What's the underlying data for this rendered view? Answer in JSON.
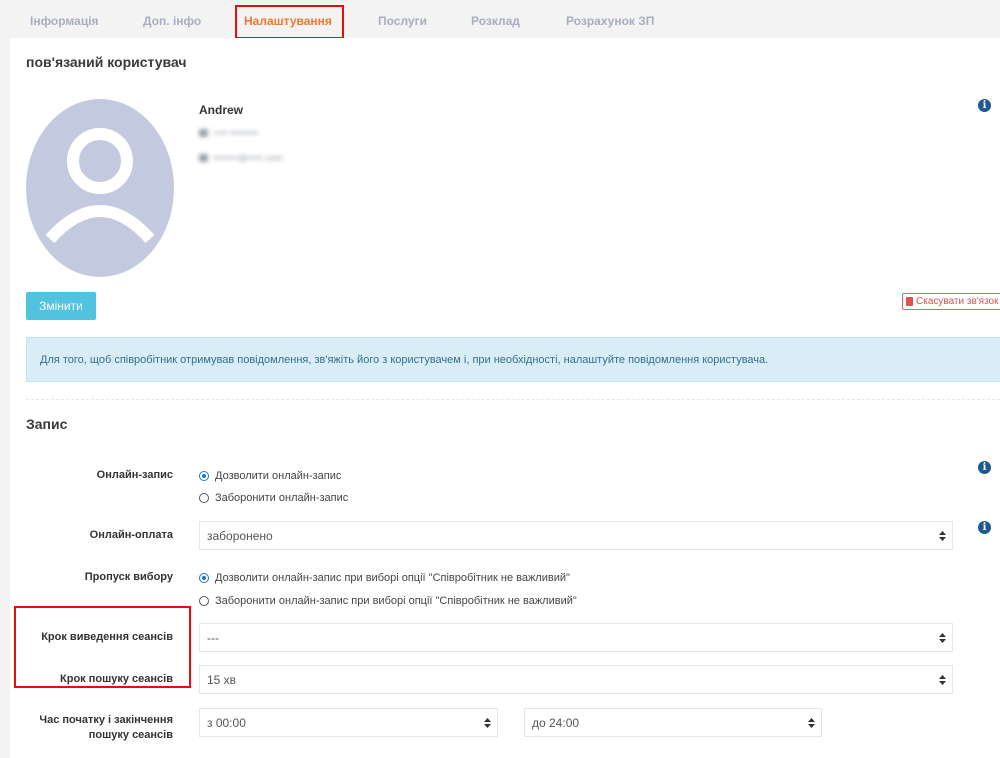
{
  "tabs": [
    {
      "label": "Інформація",
      "active": false
    },
    {
      "label": "Доп. інфо",
      "active": false
    },
    {
      "label": "Налаштування",
      "active": true
    },
    {
      "label": "Послуги",
      "active": false
    },
    {
      "label": "Розклад",
      "active": false
    },
    {
      "label": "Розрахунок ЗП",
      "active": false
    }
  ],
  "linked_user": {
    "title": "пов'язаний користувач",
    "name": "Andrew",
    "change_button": "Змінити",
    "unlink_button": "Скасувати зв'язок"
  },
  "alert_text": "Для того, щоб співробітник отримував повідомлення, зв'яжіть його з користувачем і, при необхідності, налаштуйте повідомлення користувача.",
  "booking": {
    "title": "Запис",
    "online_booking": {
      "label": "Онлайн-запис",
      "options": [
        "Дозволити онлайн-запис",
        "Заборонити онлайн-запис"
      ],
      "selected": 0
    },
    "online_payment": {
      "label": "Онлайн-оплата",
      "value": "заборонено"
    },
    "skip_choice": {
      "label": "Пропуск вибору",
      "options": [
        "Дозволити онлайн-запис при виборі опції \"Співробітник не важливий\"",
        "Заборонити онлайн-запис при виборі опції \"Співробітник не важливий\""
      ],
      "selected": 0
    },
    "session_display_step": {
      "label": "Крок виведення сеансів",
      "value": "---"
    },
    "session_search_step": {
      "label": "Крок пошуку сеансів",
      "value": "15 хв"
    },
    "search_time": {
      "label_line1": "Час початку і закінчення",
      "label_line2": "пошуку сеансів",
      "from": "з 00:00",
      "to": "до 24:00"
    }
  },
  "colors": {
    "accent_tab": "#f0772e",
    "primary_button": "#4fc3e0",
    "danger": "#d9534f",
    "alert_bg": "#d9edf7",
    "highlight": "#e20f0f",
    "radio": "#1a73d9",
    "info_icon": "#1c5a8f"
  }
}
